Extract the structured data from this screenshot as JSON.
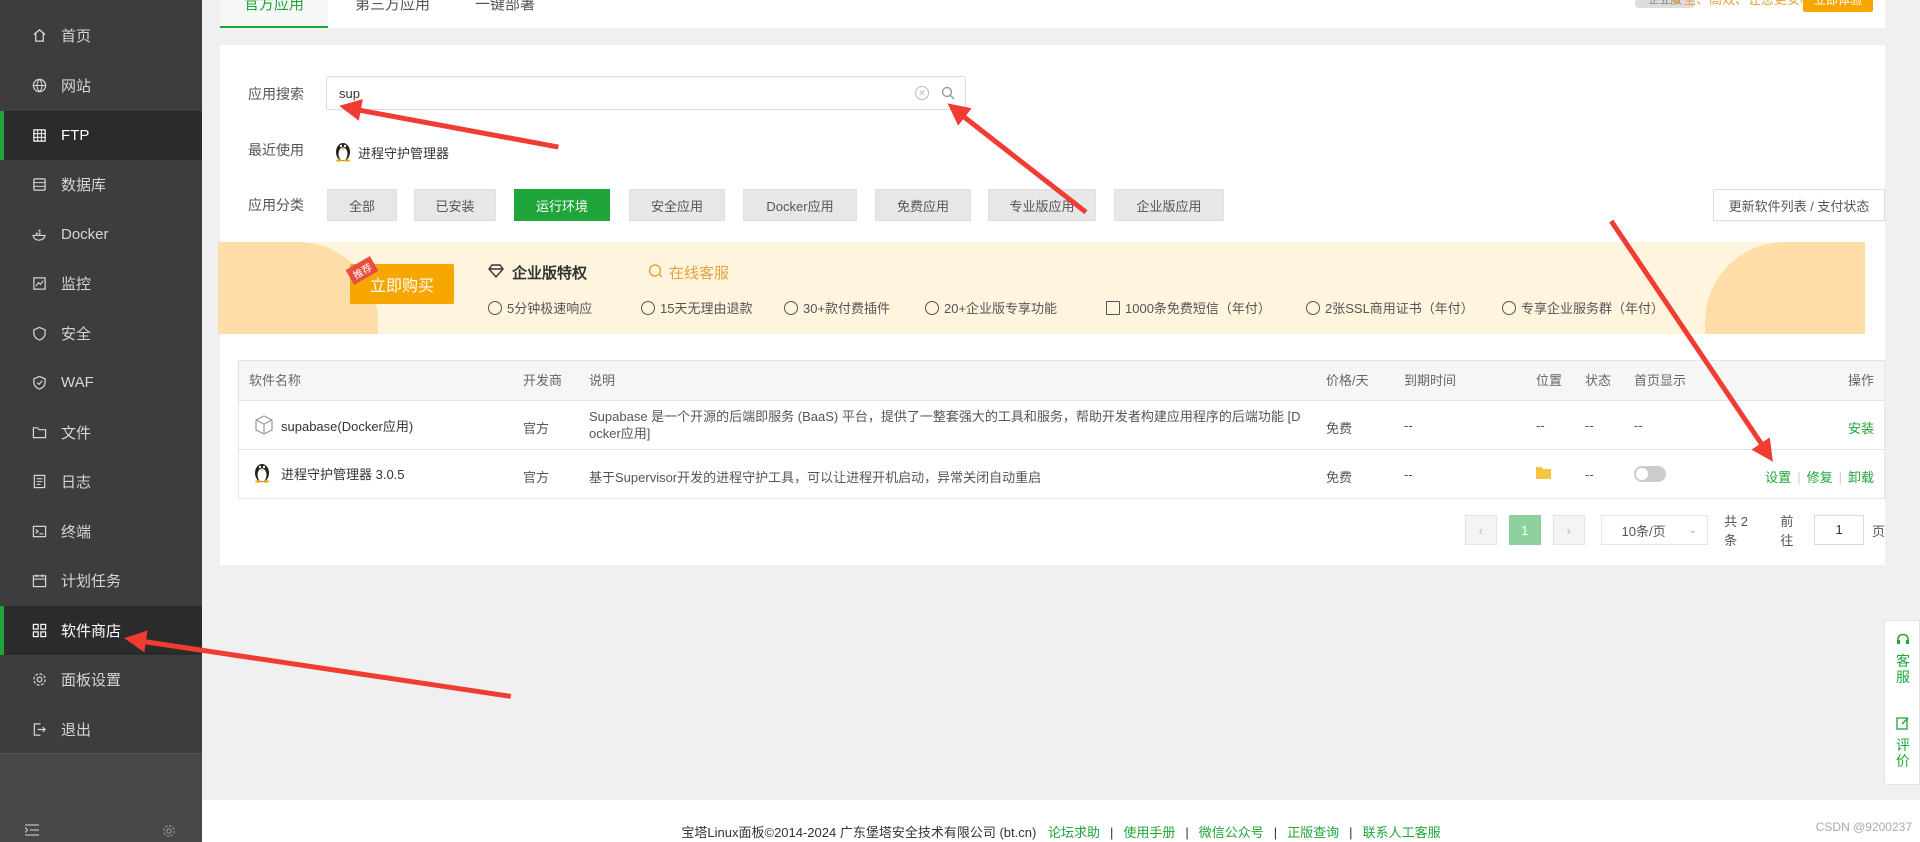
{
  "sidebar": {
    "items": [
      {
        "label": "首页",
        "icon": "home-icon"
      },
      {
        "label": "网站",
        "icon": "globe-icon"
      },
      {
        "label": "FTP",
        "icon": "ftp-icon"
      },
      {
        "label": "数据库",
        "icon": "database-icon"
      },
      {
        "label": "Docker",
        "icon": "docker-icon"
      },
      {
        "label": "监控",
        "icon": "monitor-icon"
      },
      {
        "label": "安全",
        "icon": "shield-icon"
      },
      {
        "label": "WAF",
        "icon": "waf-icon"
      },
      {
        "label": "文件",
        "icon": "folder-icon"
      },
      {
        "label": "日志",
        "icon": "log-icon"
      },
      {
        "label": "终端",
        "icon": "terminal-icon"
      },
      {
        "label": "计划任务",
        "icon": "calendar-icon"
      },
      {
        "label": "软件商店",
        "icon": "grid-icon"
      },
      {
        "label": "面板设置",
        "icon": "gear-icon"
      },
      {
        "label": "退出",
        "icon": "logout-icon"
      }
    ]
  },
  "tabs": [
    "官方应用",
    "第三方应用",
    "一键部署"
  ],
  "topbar": {
    "badge": "企业版",
    "promo": "安全、高效、让您更安心",
    "try_label": "立即体验"
  },
  "search": {
    "label": "应用搜索",
    "value": "sup"
  },
  "recent": {
    "label": "最近使用",
    "item": "进程守护管理器"
  },
  "categories": {
    "label": "应用分类",
    "items": [
      "全部",
      "已安装",
      "运行环境",
      "安全应用",
      "Docker应用",
      "免费应用",
      "专业版应用",
      "企业版应用"
    ],
    "active_index": 2
  },
  "update_button": "更新软件列表 / 支付状态",
  "banner": {
    "buy_label": "立即购买",
    "buy_tag": "推荐",
    "title_enterprise": "企业版特权",
    "title_service": "在线客服",
    "features": [
      "5分钟极速响应",
      "15天无理由退款",
      "30+款付费插件",
      "20+企业版专享功能",
      "1000条免费短信（年付）",
      "2张SSL商用证书（年付）",
      "专享企业服务群（年付）"
    ]
  },
  "table": {
    "headers": [
      "软件名称",
      "开发商",
      "说明",
      "价格/天",
      "到期时间",
      "位置",
      "状态",
      "首页显示",
      "操作"
    ],
    "rows": [
      {
        "name": "supabase(Docker应用)",
        "vendor": "官方",
        "desc_line1": "Supabase 是一个开源的后端即服务 (BaaS) 平台，提供了一整套强大的工具和服务，帮助开发者构建应用程序的后端功能 [D",
        "desc_line2": "ocker应用]",
        "price": "免费",
        "expire": "--",
        "location": "--",
        "status": "--",
        "home": "--",
        "action": "安装"
      },
      {
        "name": "进程守护管理器 3.0.5",
        "vendor": "官方",
        "desc_line1": "基于Supervisor开发的进程守护工具，可以让进程开机启动，异常关闭自动重启",
        "price": "免费",
        "expire": "--",
        "status": "--",
        "home_toggle_on": false,
        "actions": [
          "设置",
          "修复",
          "卸载"
        ]
      }
    ]
  },
  "pager": {
    "prev": "‹",
    "current": "1",
    "next": "›",
    "page_size": "10条/页",
    "total": "共 2 条",
    "goto_label": "前往",
    "goto_value": "1",
    "page_unit": "页"
  },
  "footer": {
    "copyright": "宝塔Linux面板©2014-2024 广东堡塔安全技术有限公司 (bt.cn)",
    "links": [
      "论坛求助",
      "使用手册",
      "微信公众号",
      "正版查询",
      "联系人工客服"
    ],
    "watermark": "CSDN @9200237"
  },
  "float": {
    "service": "客服",
    "review": "评价"
  },
  "colors": {
    "accent": "#20a53a",
    "sidebar": "#3d3d3d",
    "arrow": "#f03c32",
    "gold": "#f7a600"
  }
}
